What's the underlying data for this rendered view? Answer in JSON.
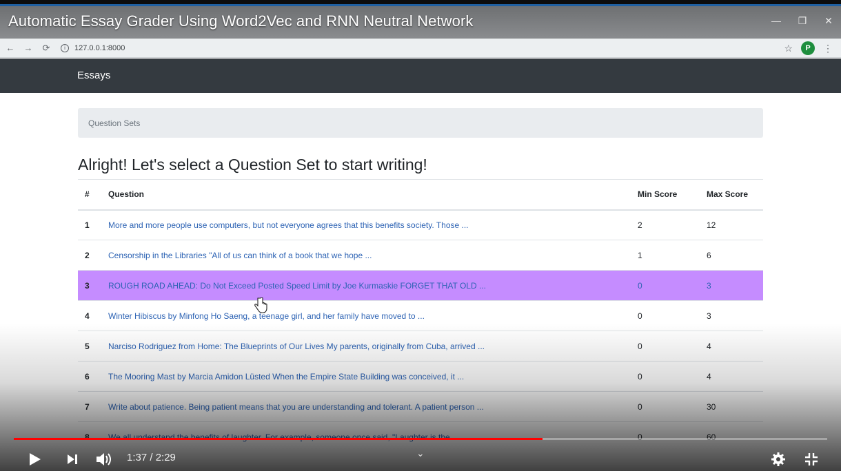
{
  "video": {
    "title": "Automatic Essay Grader Using Word2Vec and RNN Neutral Network",
    "time_display": "1:37 / 2:29",
    "progress_fraction": 0.65
  },
  "browser": {
    "url": "127.0.0.1:8000",
    "avatar_letter": "P"
  },
  "navbar": {
    "brand": "Essays"
  },
  "breadcrumb": {
    "label": "Question Sets"
  },
  "heading": "Alright! Let's select a Question Set to start writing!",
  "table": {
    "headers": [
      "#",
      "Question",
      "Min Score",
      "Max Score"
    ],
    "rows": [
      {
        "num": "1",
        "question": "More and more people use computers, but not everyone agrees that this benefits society. Those ...",
        "min": "2",
        "max": "12"
      },
      {
        "num": "2",
        "question": "Censorship in the Libraries \"All of us can think of a book that we hope ...",
        "min": "1",
        "max": "6"
      },
      {
        "num": "3",
        "question": "ROUGH ROAD AHEAD: Do Not Exceed Posted Speed Limit by Joe Kurmaskie FORGET THAT OLD ...",
        "min": "0",
        "max": "3"
      },
      {
        "num": "4",
        "question": "Winter Hibiscus by Minfong Ho Saeng, a teenage girl, and her family have moved to ...",
        "min": "0",
        "max": "3"
      },
      {
        "num": "5",
        "question": "Narciso Rodriguez from Home: The Blueprints of Our Lives My parents, originally from Cuba, arrived ...",
        "min": "0",
        "max": "4"
      },
      {
        "num": "6",
        "question": "The Mooring Mast by Marcia Amidon Lüsted When the Empire State Building was conceived, it ...",
        "min": "0",
        "max": "4"
      },
      {
        "num": "7",
        "question": "Write about patience. Being patient means that you are understanding and tolerant. A patient person ...",
        "min": "0",
        "max": "30"
      },
      {
        "num": "8",
        "question": "We all understand the benefits of laughter. For example, someone once said, \"Laughter is the ...",
        "min": "0",
        "max": "60"
      }
    ],
    "selected_row": 3
  },
  "colors": {
    "navbar": "#343a40",
    "selected_row": "#c58cff",
    "link": "#2d63b4",
    "progress": "#ff0000"
  }
}
